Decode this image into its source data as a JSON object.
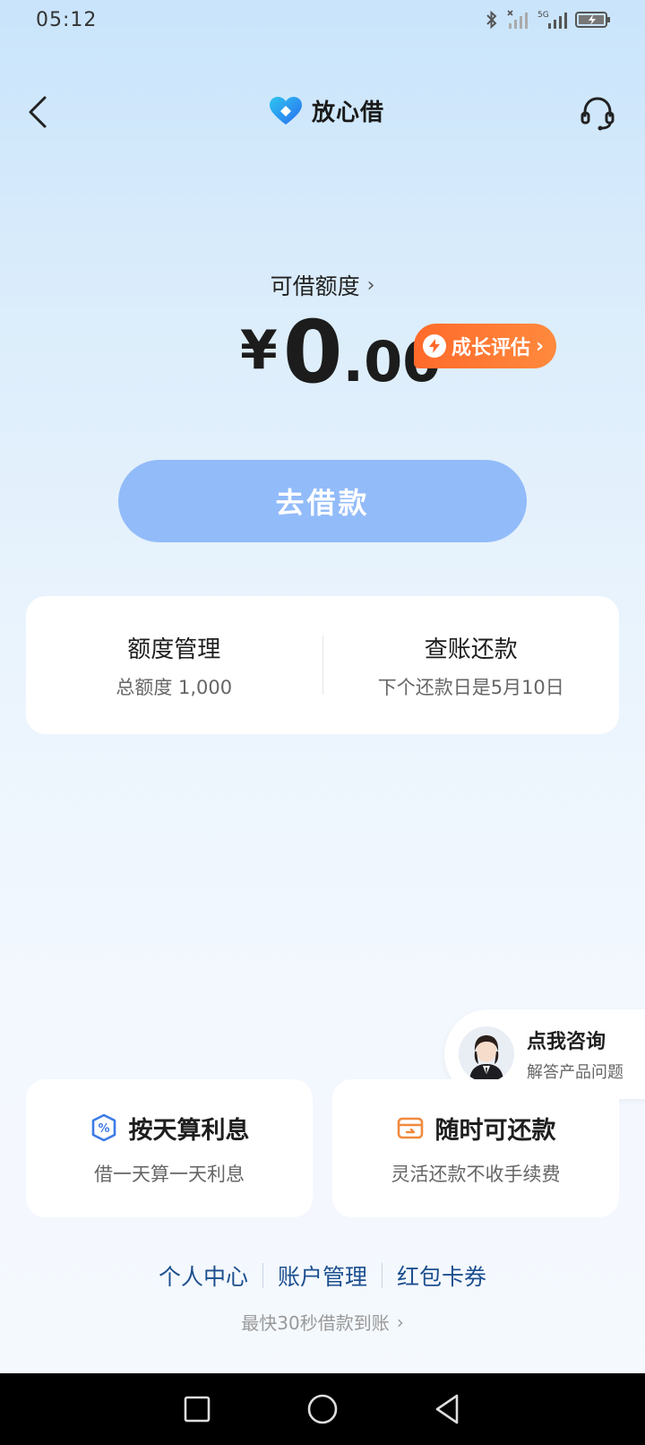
{
  "status_bar": {
    "time": "05:12"
  },
  "header": {
    "title": "放心借"
  },
  "limit": {
    "label": "可借额度",
    "chevron": "›",
    "currency": "¥",
    "integer": "0",
    "decimal": ".00",
    "growth_badge": "成长评估",
    "growth_chevron": "›"
  },
  "borrow_button": "去借款",
  "info_card": {
    "left": {
      "title": "额度管理",
      "subtitle": "总额度 1,000"
    },
    "right": {
      "title": "查账还款",
      "subtitle": "下个还款日是5月10日"
    }
  },
  "consult": {
    "title": "点我咨询",
    "subtitle": "解答产品问题"
  },
  "features": [
    {
      "icon": "percent-shield-icon",
      "title": "按天算利息",
      "subtitle": "借一天算一天利息"
    },
    {
      "icon": "card-repay-icon",
      "title": "随时可还款",
      "subtitle": "灵活还款不收手续费"
    }
  ],
  "links": [
    "个人中心",
    "账户管理",
    "红包卡券"
  ],
  "tagline": {
    "text": "最快30秒借款到账",
    "chevron": "›"
  },
  "colors": {
    "accent_blue": "#92bbf9",
    "badge_orange": "#ff6a2b",
    "link_blue": "#1c4f8f",
    "repay_orange": "#f08a3e",
    "interest_blue": "#3d7be6"
  }
}
